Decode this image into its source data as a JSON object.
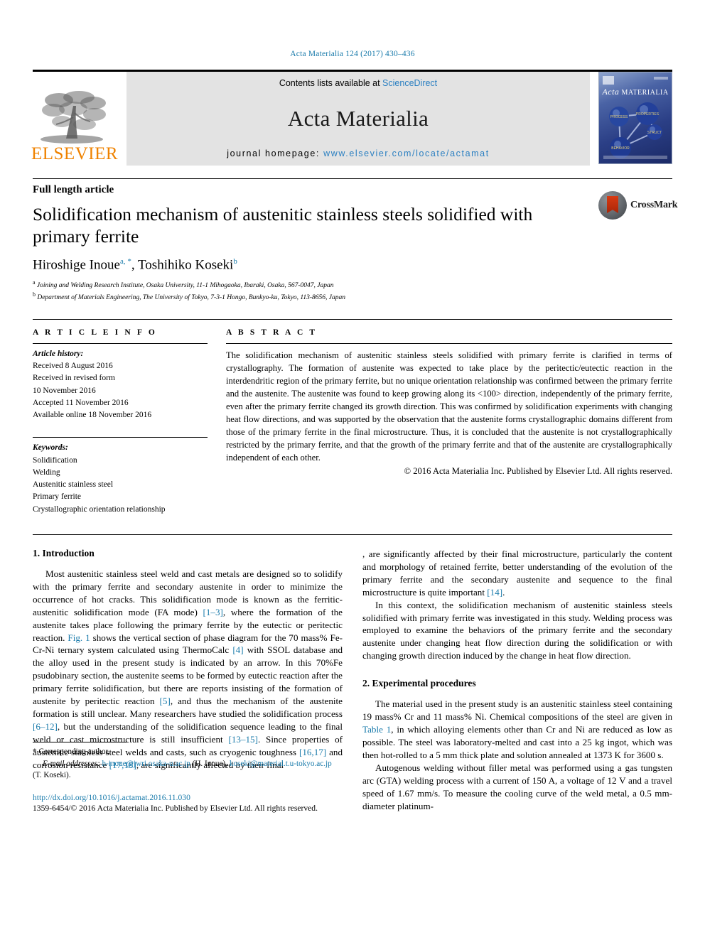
{
  "running_head": "Acta Materialia 124 (2017) 430–436",
  "masthead": {
    "publisher_logo_text": "ELSEVIER",
    "contents_prefix": "Contents lists available at ",
    "contents_link": "ScienceDirect",
    "journal_name": "Acta Materialia",
    "homepage_prefix": "journal homepage: ",
    "homepage_url": "www.elsevier.com/locate/actamat",
    "cover": {
      "title_italic": "Acta",
      "title_caps": "MATERIALIA",
      "node_labels": [
        "PROCESS",
        "PROPERTIES",
        "STRUCTURE",
        "BEHAVIOR"
      ]
    }
  },
  "article": {
    "type": "Full length article",
    "title": "Solidification mechanism of austenitic stainless steels solidified with primary ferrite",
    "authors": [
      {
        "name": "Hiroshige Inoue",
        "marks": "a, *"
      },
      {
        "name": "Toshihiko Koseki",
        "marks": "b"
      }
    ],
    "authors_line": "Hiroshige Inoue a, *, Toshihiko Koseki b",
    "affiliations": [
      {
        "mark": "a",
        "text": "Joining and Welding Research Institute, Osaka University, 11-1 Mihogaoka, Ibaraki, Osaka, 567-0047, Japan"
      },
      {
        "mark": "b",
        "text": "Department of Materials Engineering, The University of Tokyo, 7-3-1 Hongo, Bunkyo-ku, Tokyo, 113-8656, Japan"
      }
    ],
    "crossmark_label": "CrossMark"
  },
  "article_info": {
    "heading": "A R T I C L E  I N F O",
    "history_label": "Article history:",
    "history": [
      "Received 8 August 2016",
      "Received in revised form",
      "10 November 2016",
      "Accepted 11 November 2016",
      "Available online 18 November 2016"
    ],
    "keywords_label": "Keywords:",
    "keywords": [
      "Solidification",
      "Welding",
      "Austenitic stainless steel",
      "Primary ferrite",
      "Crystallographic orientation relationship"
    ]
  },
  "abstract": {
    "heading": "A B S T R A C T",
    "text": "The solidification mechanism of austenitic stainless steels solidified with primary ferrite is clarified in terms of crystallography. The formation of austenite was expected to take place by the peritectic/eutectic reaction in the interdendritic region of the primary ferrite, but no unique orientation relationship was confirmed between the primary ferrite and the austenite. The austenite was found to keep growing along its <100> direction, independently of the primary ferrite, even after the primary ferrite changed its growth direction. This was confirmed by solidification experiments with changing heat flow directions, and was supported by the observation that the austenite forms crystallographic domains different from those of the primary ferrite in the final microstructure. Thus, it is concluded that the austenite is not crystallographically restricted by the primary ferrite, and that the growth of the primary ferrite and that of the austenite are crystallographically independent of each other.",
    "copyright": "© 2016 Acta Materialia Inc. Published by Elsevier Ltd. All rights reserved."
  },
  "body": {
    "intro_heading": "1. Introduction",
    "intro_p1_a": "Most austenitic stainless steel weld and cast metals are designed so to solidify with the primary ferrite and secondary austenite in order to minimize the occurrence of hot cracks. This solidification mode is known as the ferritic-austenitic solidification mode (FA mode) ",
    "intro_p1_cite1": "[1–3]",
    "intro_p1_b": ", where the formation of the austenite takes place following the primary ferrite by the eutectic or peritectic reaction. ",
    "intro_p1_fig": "Fig. 1",
    "intro_p1_c": " shows the vertical section of phase diagram for the 70 mass% Fe-Cr-Ni ternary system calculated using ThermoCalc ",
    "intro_p1_cite2": "[4]",
    "intro_p1_d": " with SSOL database and the alloy used in the present study is indicated by an arrow. In this 70%Fe psudobinary section, the austenite seems to be formed by eutectic reaction after the primary ferrite solidification, but there are reports insisting of the formation of austenite by peritectic reaction ",
    "intro_p1_cite3": "[5]",
    "intro_p1_e": ", and thus the mechanism of the austenite formation is still unclear. Many researchers have studied the solidification process ",
    "intro_p1_cite4": "[6–12]",
    "intro_p1_f": ", but the understanding of the solidification sequence leading to the final weld or cast microstructure is still insufficient ",
    "intro_p1_cite5": "[13–15]",
    "intro_p1_g": ". Since properties of austenitic stainless steel welds and casts, such as cryogenic toughness ",
    "intro_p1_cite6": "[16,17]",
    "intro_p1_h": " and corrosion resistance ",
    "intro_p1_cite7": "[17,18]",
    "intro_p1_i": ", are significantly affected by their final microstructure, particularly the content and morphology of retained ferrite, better understanding of the evolution of the primary ferrite and the secondary austenite and sequence to the final microstructure is quite important ",
    "intro_p1_cite8": "[14]",
    "intro_p1_j": ".",
    "intro_p2": "In this context, the solidification mechanism of austenitic stainless steels solidified with primary ferrite was investigated in this study. Welding process was employed to examine the behaviors of the primary ferrite and the secondary austenite under changing heat flow direction during the solidification or with changing growth direction induced by the change in heat flow direction.",
    "exp_heading": "2. Experimental procedures",
    "exp_p1_a": "The material used in the present study is an austenitic stainless steel containing 19 mass% Cr and 11 mass% Ni. Chemical compositions of the steel are given in ",
    "exp_p1_table": "Table 1",
    "exp_p1_b": ", in which alloying elements other than Cr and Ni are reduced as low as possible. The steel was laboratory-melted and cast into a 25 kg ingot, which was then hot-rolled to a 5 mm thick plate and solution annealed at 1373 K for 3600 s.",
    "exp_p2": "Autogenous welding without filler metal was performed using a gas tungsten arc (GTA) welding process with a current of 150 A, a voltage of 12 V and a travel speed of 1.67 mm/s. To measure the cooling curve of the weld metal, a 0.5 mm-diameter platinum-"
  },
  "footnotes": {
    "corresponding": "* Corresponding author.",
    "email_label": "E-mail addresses:",
    "email1": "h-inoue@jwri.osaka-u.ac.jp",
    "email1_owner": " (H. Inoue), ",
    "email2": "koseki@material.t.u-tokyo.ac.jp",
    "email2_owner": " (T. Koseki).",
    "doi": "http://dx.doi.org/10.1016/j.actamat.2016.11.030",
    "issn": "1359-6454/© 2016 Acta Materialia Inc. Published by Elsevier Ltd. All rights reserved."
  },
  "colors": {
    "link": "#1a7bab",
    "elsevier_orange": "#ef8200",
    "sciencedirect_blue": "#2a7fc1",
    "band_gray": "#e3e3e3"
  }
}
